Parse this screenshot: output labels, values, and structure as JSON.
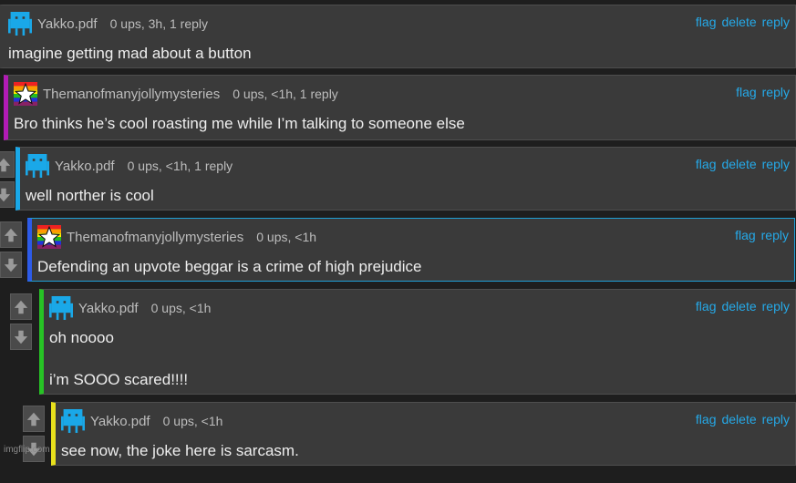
{
  "colors": {
    "link": "#25a9e8",
    "avatar_blue": "#1aa8e8",
    "accent_magenta": "#b21bb5",
    "accent_cyan": "#1aa8e8",
    "accent_blue": "#2d5be8",
    "accent_green": "#27c325",
    "accent_yellow": "#e8e01c"
  },
  "comments": [
    {
      "user": "Yakko.pdf",
      "meta": "0 ups, 3h, 1 reply",
      "actions": [
        "flag",
        "delete",
        "reply"
      ],
      "body": [
        "imagine getting mad about a button"
      ],
      "avatar": "pixel-avatar-icon"
    },
    {
      "user": "Themanofmanyjollymysteries",
      "meta": "0 ups, <1h, 1 reply",
      "actions": [
        "flag",
        "reply"
      ],
      "body": [
        "Bro thinks he’s cool roasting me while I’m talking to someone else"
      ],
      "avatar": "rainbow-star-avatar-icon"
    },
    {
      "user": "Yakko.pdf",
      "meta": "0 ups, <1h, 1 reply",
      "actions": [
        "flag",
        "delete",
        "reply"
      ],
      "body": [
        "well norther is cool"
      ],
      "avatar": "pixel-avatar-icon"
    },
    {
      "user": "Themanofmanyjollymysteries",
      "meta": "0 ups, <1h",
      "actions": [
        "flag",
        "reply"
      ],
      "body": [
        "Defending an upvote beggar is a crime of high prejudice"
      ],
      "avatar": "rainbow-star-avatar-icon"
    },
    {
      "user": "Yakko.pdf",
      "meta": "0 ups, <1h",
      "actions": [
        "flag",
        "delete",
        "reply"
      ],
      "body": [
        "oh noooo",
        "i’m SOOO scared!!!!"
      ],
      "avatar": "pixel-avatar-icon"
    },
    {
      "user": "Yakko.pdf",
      "meta": "0 ups, <1h",
      "actions": [
        "flag",
        "delete",
        "reply"
      ],
      "body": [
        "see now, the joke here is sarcasm."
      ],
      "avatar": "pixel-avatar-icon"
    }
  ],
  "watermark": "imgflip.com"
}
